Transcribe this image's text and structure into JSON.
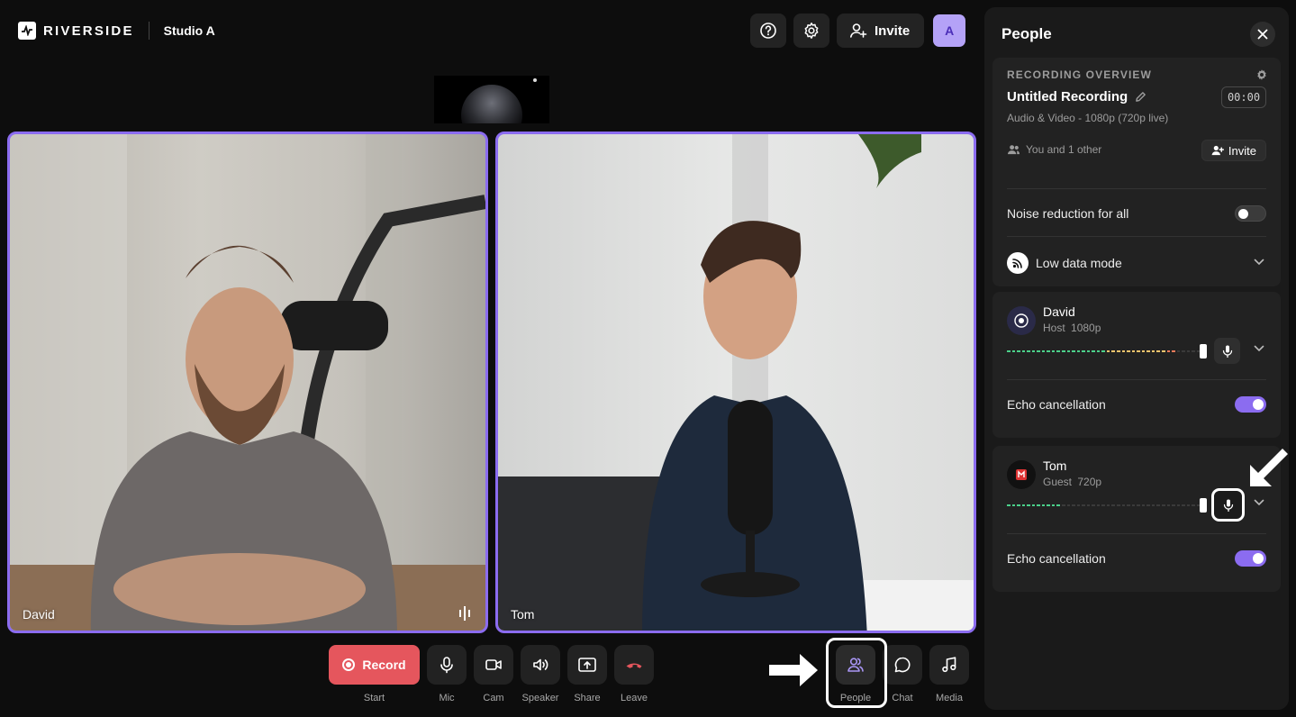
{
  "header": {
    "brand": "RIVERSIDE",
    "studio_name": "Studio A",
    "invite_label": "Invite",
    "avatar_initial": "A"
  },
  "tiles": [
    {
      "name": "David"
    },
    {
      "name": "Tom"
    }
  ],
  "controls": {
    "record_label": "Record",
    "start_label": "Start",
    "mic": "Mic",
    "cam": "Cam",
    "speaker": "Speaker",
    "share": "Share",
    "leave": "Leave",
    "people": "People",
    "chat": "Chat",
    "media": "Media"
  },
  "panel": {
    "title": "People",
    "overview": {
      "heading": "RECORDING OVERVIEW",
      "title": "Untitled Recording",
      "timer": "00:00",
      "subtitle": "Audio & Video - 1080p (720p live)",
      "participants": "You and 1 other",
      "invite_label": "Invite"
    },
    "noise_reduction": {
      "label": "Noise reduction for all",
      "enabled": false
    },
    "low_data_mode": {
      "label": "Low data mode"
    },
    "people": [
      {
        "name": "David",
        "role": "Host",
        "resolution": "1080p",
        "echo_label": "Echo cancellation",
        "echo_enabled": true,
        "level": 0.86
      },
      {
        "name": "Tom",
        "role": "Guest",
        "resolution": "720p",
        "echo_label": "Echo cancellation",
        "echo_enabled": true,
        "level": 0.27
      }
    ]
  },
  "colors": {
    "accent": "#8b6cf0",
    "record": "#e5565d",
    "leave": "#e5565d",
    "panel_bg": "#1a1a1a"
  }
}
